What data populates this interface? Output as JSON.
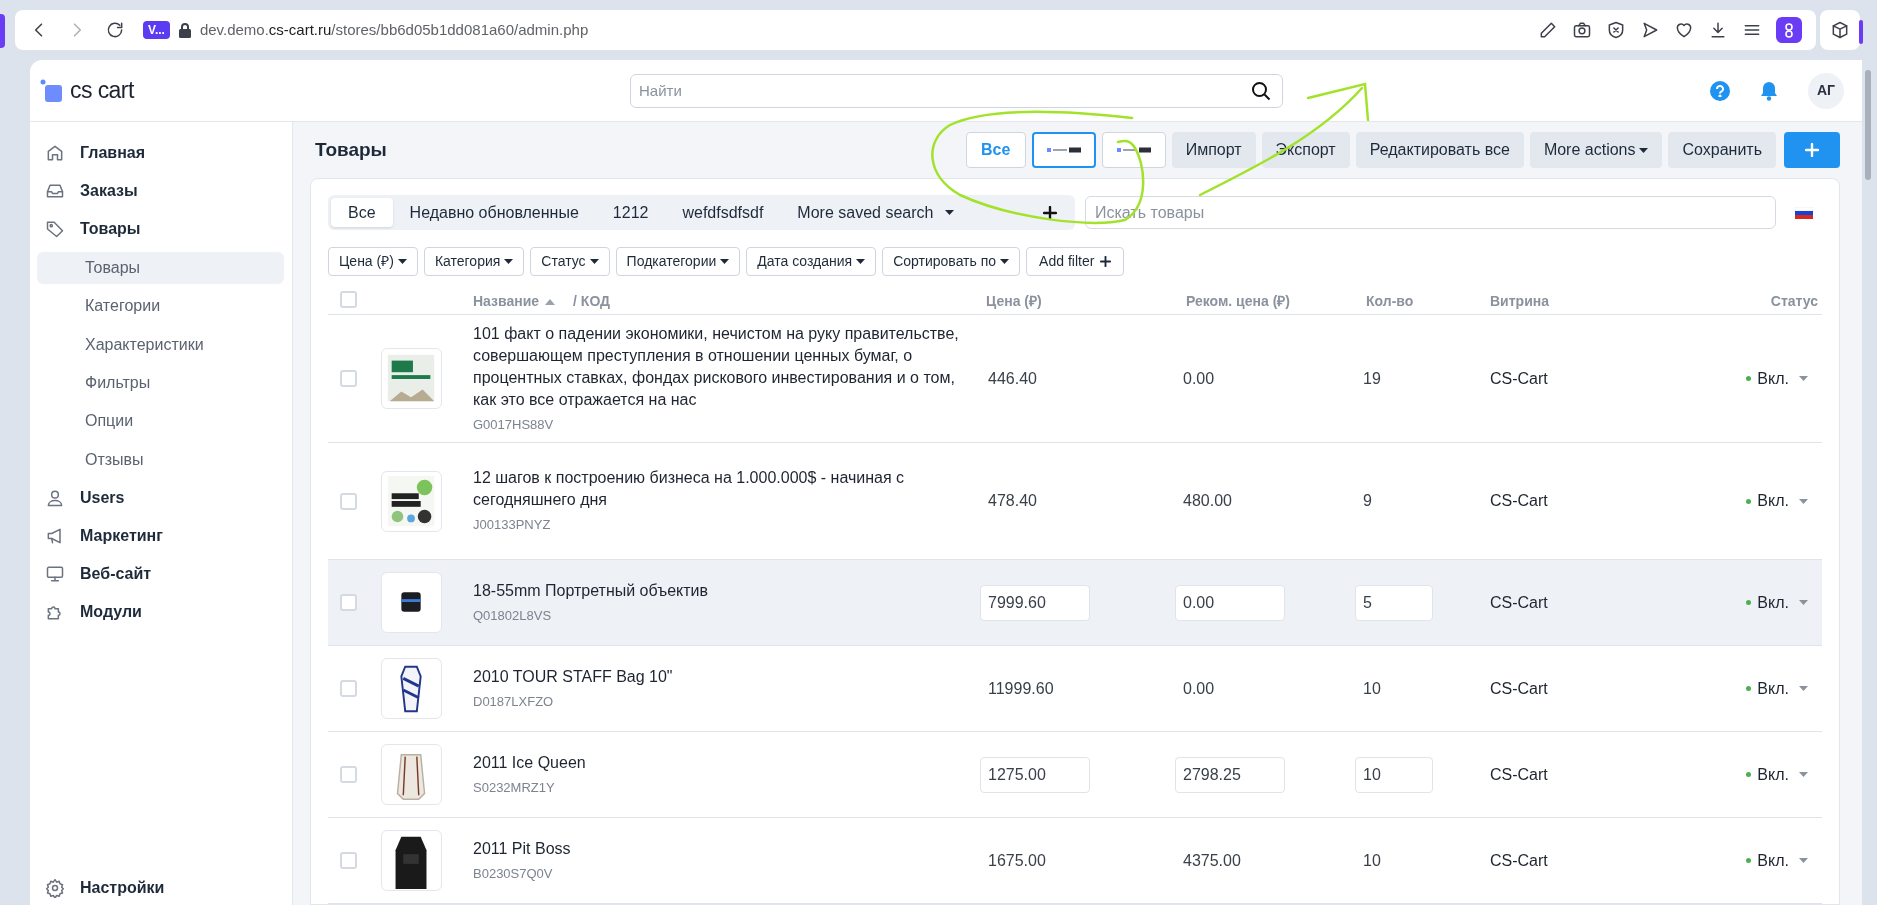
{
  "browser": {
    "profile_badge": "V...",
    "url_host_prefix": "dev.demo.",
    "url_host": "cs-cart.ru",
    "url_path": "/stores/bb6d05b1dd081a60/admin.php"
  },
  "header": {
    "logo": "cs cart",
    "search": {
      "placeholder": "Найти"
    },
    "avatar": "АГ"
  },
  "sidebar": {
    "items": [
      {
        "label": "Главная",
        "selected": false
      },
      {
        "label": "Заказы",
        "selected": false
      },
      {
        "label": "Товары",
        "selected": false,
        "children": [
          {
            "label": "Товары",
            "selected": true
          },
          {
            "label": "Категории",
            "selected": false
          },
          {
            "label": "Характеристики",
            "selected": false
          },
          {
            "label": "Фильтры",
            "selected": false
          },
          {
            "label": "Опции",
            "selected": false
          },
          {
            "label": "Отзывы",
            "selected": false
          }
        ]
      },
      {
        "label": "Users",
        "selected": false
      },
      {
        "label": "Маркетинг",
        "selected": false
      },
      {
        "label": "Веб-сайт",
        "selected": false
      },
      {
        "label": "Модули",
        "selected": false
      }
    ],
    "footer": {
      "label": "Настройки"
    }
  },
  "page": {
    "title": "Товары",
    "views": [
      {
        "kind": "text",
        "label": "Все",
        "selected": false
      },
      {
        "kind": "logo",
        "selected": true
      },
      {
        "kind": "logo",
        "selected": false
      }
    ],
    "actions": [
      {
        "kind": "plain",
        "label": "Импорт"
      },
      {
        "kind": "plain",
        "label": "Экспорт"
      },
      {
        "kind": "plain",
        "label": "Редактировать все"
      },
      {
        "kind": "dropdown",
        "label": "More actions"
      },
      {
        "kind": "plain",
        "label": "Сохранить"
      },
      {
        "kind": "primary"
      }
    ]
  },
  "saved_searches": {
    "tabs": [
      {
        "label": "Все",
        "selected": true
      },
      {
        "label": "Недавно обновленные",
        "selected": false
      },
      {
        "label": "1212",
        "selected": false
      },
      {
        "label": "wefdfsdfsdf",
        "selected": false
      }
    ],
    "more": "More saved search"
  },
  "product_search": {
    "placeholder": "Искать товары"
  },
  "filters": [
    {
      "kind": "dropdown",
      "label": "Цена (₽)"
    },
    {
      "kind": "dropdown",
      "label": "Категория"
    },
    {
      "kind": "dropdown",
      "label": "Статус"
    },
    {
      "kind": "dropdown",
      "label": "Подкатегории"
    },
    {
      "kind": "dropdown",
      "label": "Дата создания"
    },
    {
      "kind": "dropdown",
      "label": "Сортировать по"
    },
    {
      "kind": "add",
      "label": "Add filter"
    }
  ],
  "table": {
    "select_all_checked": false,
    "columns": [
      {
        "label": "Название",
        "sorted_ascending": true
      },
      {
        "label": "/ КОД"
      },
      {
        "label": "Цена (₽)"
      },
      {
        "label": "Реком. цена (₽)"
      },
      {
        "label": "Кол-во"
      },
      {
        "label": "Витрина"
      },
      {
        "label": "Статус"
      }
    ],
    "rows": [
      {
        "checked": false,
        "highlighted": false,
        "editable": false,
        "name": "101 факт о падении экономики, нечистом на руку правительстве, совершающем преступления в отношении ценных бумаг, о процентных ставках, фондах рискового инвестирования и о том, как это все отражается на нас",
        "code": "G0017HS88V",
        "price": "446.40",
        "list_price": "0.00",
        "quantity": "19",
        "storefront": "CS-Cart",
        "status": {
          "label": "Вкл.",
          "color": "#4caf50"
        }
      },
      {
        "checked": false,
        "highlighted": false,
        "editable": false,
        "name": "12 шагов к построению бизнеса на 1.000.000$ - начиная с сегодняшнего дня",
        "code": "J00133PNYZ",
        "price": "478.40",
        "list_price": "480.00",
        "quantity": "9",
        "storefront": "CS-Cart",
        "status": {
          "label": "Вкл.",
          "color": "#4caf50"
        }
      },
      {
        "checked": false,
        "highlighted": true,
        "editable": true,
        "name": "18-55mm Портретный объектив",
        "code": "Q01802L8VS",
        "price": "7999.60",
        "list_price": "0.00",
        "quantity": "5",
        "storefront": "CS-Cart",
        "status": {
          "label": "Вкл.",
          "color": "#4caf50"
        }
      },
      {
        "checked": false,
        "highlighted": false,
        "editable": false,
        "name": "2010 TOUR STAFF Bag 10\"",
        "code": "D0187LXFZO",
        "price": "11999.60",
        "list_price": "0.00",
        "quantity": "10",
        "storefront": "CS-Cart",
        "status": {
          "label": "Вкл.",
          "color": "#4caf50"
        }
      },
      {
        "checked": false,
        "highlighted": false,
        "editable": true,
        "name": "2011 Ice Queen",
        "code": "S0232MRZ1Y",
        "price": "1275.00",
        "list_price": "2798.25",
        "quantity": "10",
        "storefront": "CS-Cart",
        "status": {
          "label": "Вкл.",
          "color": "#4caf50"
        }
      },
      {
        "checked": false,
        "highlighted": false,
        "editable": false,
        "name": "2011 Pit Boss",
        "code": "B0230S7Q0V",
        "price": "1675.00",
        "list_price": "4375.00",
        "quantity": "10",
        "storefront": "CS-Cart",
        "status": {
          "label": "Вкл.",
          "color": "#4caf50"
        }
      }
    ]
  }
}
